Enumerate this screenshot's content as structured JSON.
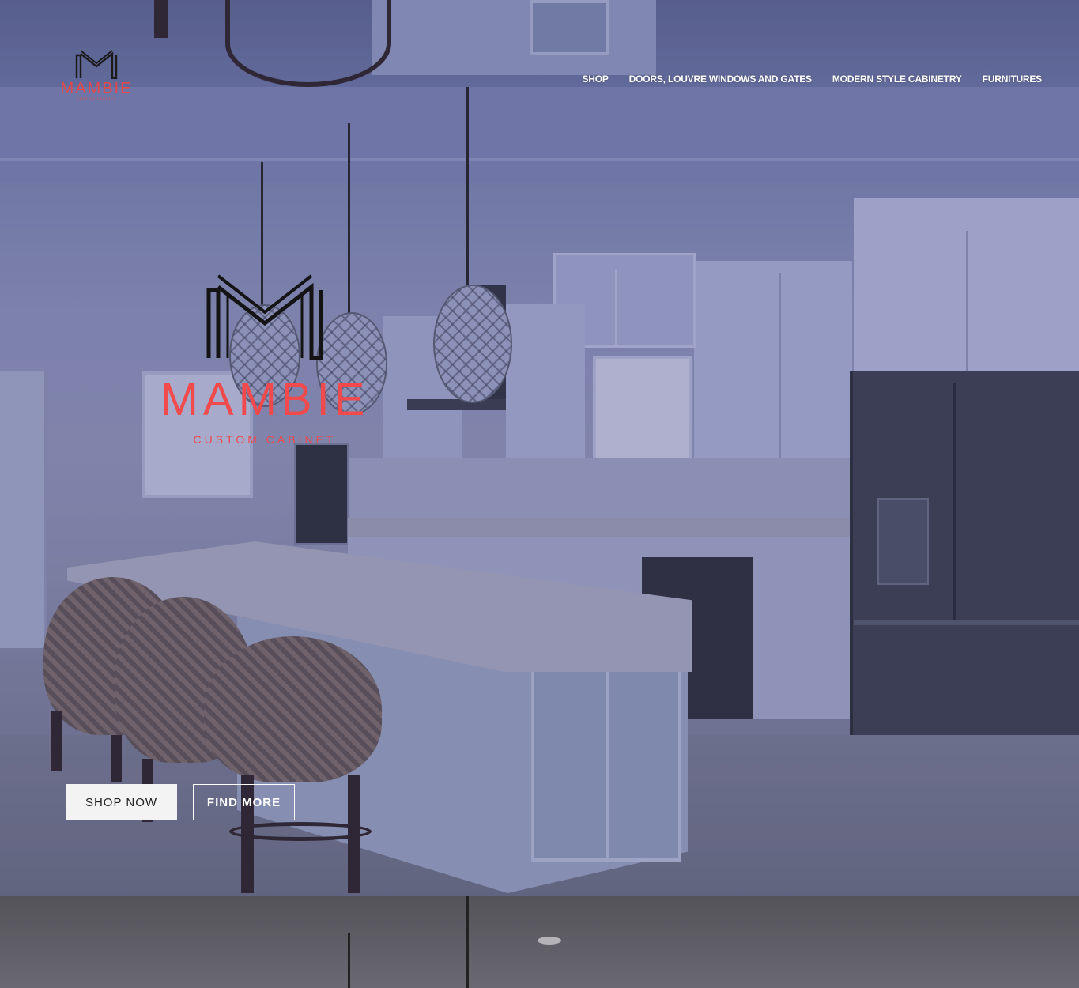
{
  "brand": {
    "name": "MAMBIE",
    "tagline": "CUSTOM CABINET",
    "small_tagline": "CUSTOM CABINET",
    "brand_color": "#f04a4d"
  },
  "nav": {
    "items": [
      {
        "label": "SHOP"
      },
      {
        "label": "DOORS, LOUVRE WINDOWS AND GATES"
      },
      {
        "label": "MODERN STYLE CABINETRY"
      },
      {
        "label": "FURNITURES"
      }
    ]
  },
  "hero": {
    "buttons": {
      "shop_now": "SHOP NOW",
      "find_more": "FIND MORE"
    }
  },
  "icons": {
    "logo_mark": "m-monogram-logo-icon"
  }
}
